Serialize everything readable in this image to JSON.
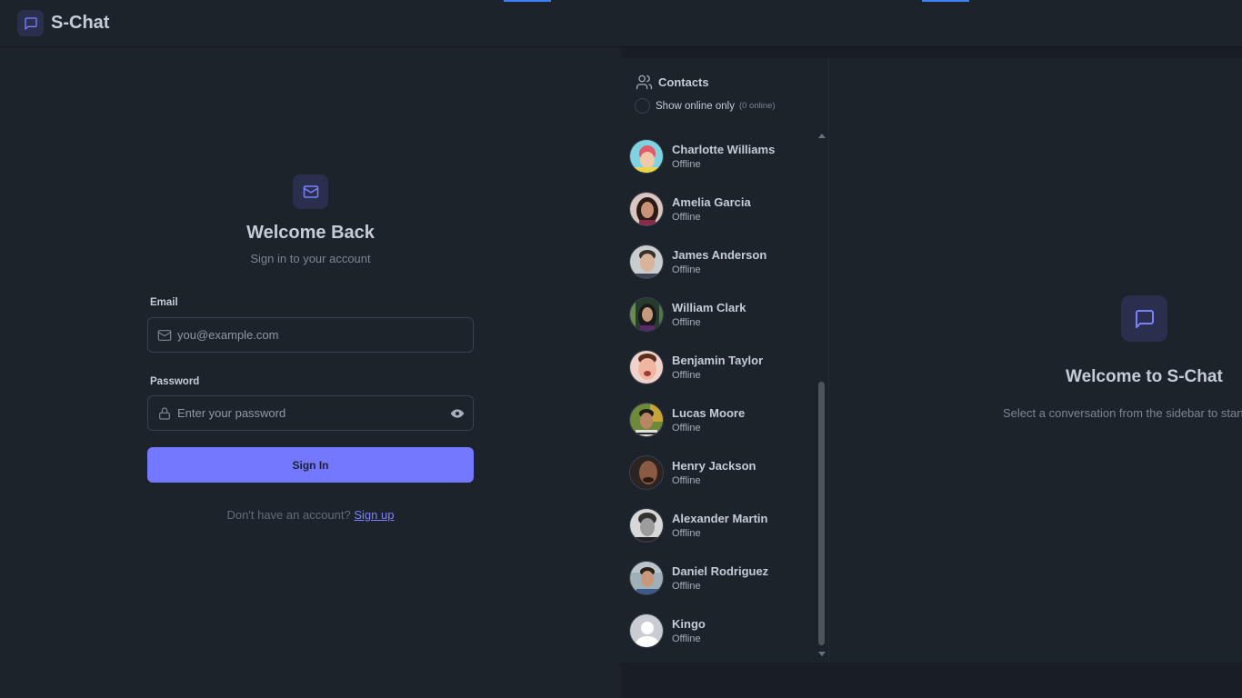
{
  "app": {
    "brand": "S-Chat"
  },
  "auth": {
    "title": "Welcome Back",
    "subtitle": "Sign in to your account",
    "email_label": "Email",
    "email_placeholder": "you@example.com",
    "password_label": "Password",
    "password_placeholder": "Enter your password",
    "signin_label": "Sign In",
    "signup_prompt": "Don't have an account?",
    "signup_link": "Sign up"
  },
  "sidebar": {
    "contacts_title": "Contacts",
    "online_toggle_label": "Show online only",
    "online_count": "(0 online)",
    "contacts": [
      {
        "name": "Charlotte Williams",
        "status": "Offline"
      },
      {
        "name": "Amelia Garcia",
        "status": "Offline"
      },
      {
        "name": "James Anderson",
        "status": "Offline"
      },
      {
        "name": "William Clark",
        "status": "Offline"
      },
      {
        "name": "Benjamin Taylor",
        "status": "Offline"
      },
      {
        "name": "Lucas Moore",
        "status": "Offline"
      },
      {
        "name": "Henry Jackson",
        "status": "Offline"
      },
      {
        "name": "Alexander Martin",
        "status": "Offline"
      },
      {
        "name": "Daniel Rodriguez",
        "status": "Offline"
      },
      {
        "name": "Kingo",
        "status": "Offline"
      }
    ]
  },
  "chat": {
    "welcome_title": "Welcome to S-Chat",
    "welcome_subtitle": "Select a conversation from the sidebar to start"
  },
  "colors": {
    "accent": "#7477ff",
    "background": "#1d232a",
    "tab_indicator": "#3b82f6"
  },
  "icons": {
    "brand": "message-square-icon",
    "auth": "mail-icon",
    "email_field": "mail-icon",
    "password_field": "lock-icon",
    "password_toggle": "eye-icon",
    "contacts": "users-icon",
    "welcome": "message-square-icon",
    "default_avatar": "user-avatar-icon"
  }
}
